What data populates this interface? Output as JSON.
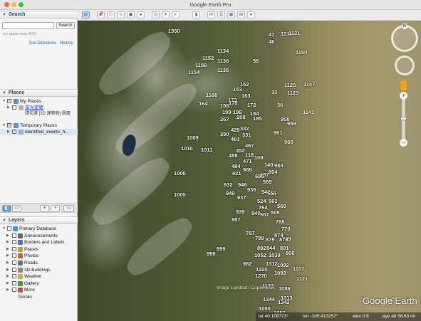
{
  "window": {
    "title": "Google Earth Pro"
  },
  "search": {
    "header": "Search",
    "placeholder": "",
    "button": "Search",
    "hint": "ex: pizza near NYC",
    "get_directions": "Get Directions",
    "history": "History"
  },
  "places": {
    "header": "Places",
    "my_places": "My Places",
    "sightseeing": "景光遊覽",
    "sightseeing_note": "請勾選 [3D 建築物] 圖層",
    "temporary": "Temporary Places",
    "kml_file": "Identified_events_fr..."
  },
  "layers": {
    "header": "Layers",
    "items": [
      {
        "label": "Primary Database",
        "icon": "globe-icon",
        "color": "#4a90d9"
      },
      {
        "label": "Announcements",
        "icon": "announcement-icon",
        "color": "#666666"
      },
      {
        "label": "Borders and Labels",
        "icon": "borders-icon",
        "color": "#3f78c8"
      },
      {
        "label": "Places",
        "icon": "place-icon",
        "color": "#c8a020"
      },
      {
        "label": "Photos",
        "icon": "photo-icon",
        "color": "#d06030"
      },
      {
        "label": "Roads",
        "icon": "road-icon",
        "color": "#707070"
      },
      {
        "label": "3D Buildings",
        "icon": "building-icon",
        "color": "#8a8a8a"
      },
      {
        "label": "Weather",
        "icon": "weather-icon",
        "color": "#e0b020"
      },
      {
        "label": "Gallery",
        "icon": "gallery-icon",
        "color": "#3aa040"
      },
      {
        "label": "More",
        "icon": "more-icon",
        "color": "#c05050"
      },
      {
        "label": "Terrain",
        "icon": "",
        "color": ""
      }
    ]
  },
  "map": {
    "imagery_credit": "Image Landsat / Copernicus",
    "brand": "Google Earth",
    "status": {
      "lat": "lat  40.108773°",
      "lon": "lon -105.413257°",
      "elev": "elev     0 ft",
      "eye_alt": "eye alt  56.63 mi"
    },
    "compass_label": "N"
  },
  "events": [
    {
      "id": "1350"
    },
    {
      "id": "47"
    },
    {
      "id": "46"
    },
    {
      "id": "131"
    },
    {
      "id": "1131"
    },
    {
      "id": "1134"
    },
    {
      "id": "1150"
    },
    {
      "id": "1152"
    },
    {
      "id": "1156"
    },
    {
      "id": "1136"
    },
    {
      "id": "1135"
    },
    {
      "id": "1154"
    },
    {
      "id": "56"
    },
    {
      "id": "152"
    },
    {
      "id": "153"
    },
    {
      "id": "1125"
    },
    {
      "id": "1147"
    },
    {
      "id": "1123"
    },
    {
      "id": "1168"
    },
    {
      "id": "163"
    },
    {
      "id": "173"
    },
    {
      "id": "33"
    },
    {
      "id": "164"
    },
    {
      "id": "158"
    },
    {
      "id": "178"
    },
    {
      "id": "172"
    },
    {
      "id": "36"
    },
    {
      "id": "1141"
    },
    {
      "id": "199"
    },
    {
      "id": "198"
    },
    {
      "id": "184"
    },
    {
      "id": "185"
    },
    {
      "id": "267"
    },
    {
      "id": "208"
    },
    {
      "id": "958"
    },
    {
      "id": "959"
    },
    {
      "id": "332"
    },
    {
      "id": "390"
    },
    {
      "id": "429"
    },
    {
      "id": "331"
    },
    {
      "id": "961"
    },
    {
      "id": "1009"
    },
    {
      "id": "461"
    },
    {
      "id": "965"
    },
    {
      "id": "467"
    },
    {
      "id": "1010"
    },
    {
      "id": "1011"
    },
    {
      "id": "352"
    },
    {
      "id": "118"
    },
    {
      "id": "488"
    },
    {
      "id": "109"
    },
    {
      "id": "471"
    },
    {
      "id": "140"
    },
    {
      "id": "984"
    },
    {
      "id": "484"
    },
    {
      "id": "988"
    },
    {
      "id": "604"
    },
    {
      "id": "921"
    },
    {
      "id": "697"
    },
    {
      "id": "696"
    },
    {
      "id": "1000"
    },
    {
      "id": "932"
    },
    {
      "id": "946"
    },
    {
      "id": "936"
    },
    {
      "id": "589"
    },
    {
      "id": "949"
    },
    {
      "id": "542"
    },
    {
      "id": "556"
    },
    {
      "id": "937"
    },
    {
      "id": "1005"
    },
    {
      "id": "524"
    },
    {
      "id": "562"
    },
    {
      "id": "939"
    },
    {
      "id": "764"
    },
    {
      "id": "568"
    },
    {
      "id": "940"
    },
    {
      "id": "507"
    },
    {
      "id": "509"
    },
    {
      "id": "997"
    },
    {
      "id": "768"
    },
    {
      "id": "770"
    },
    {
      "id": "769"
    },
    {
      "id": "787"
    },
    {
      "id": "874"
    },
    {
      "id": "788"
    },
    {
      "id": "879"
    },
    {
      "id": "873"
    },
    {
      "id": "892"
    },
    {
      "id": "844"
    },
    {
      "id": "801"
    },
    {
      "id": "999"
    },
    {
      "id": "998"
    },
    {
      "id": "1052"
    },
    {
      "id": "1039"
    },
    {
      "id": "800"
    },
    {
      "id": "982"
    },
    {
      "id": "1312"
    },
    {
      "id": "1092"
    },
    {
      "id": "1107"
    },
    {
      "id": "1320"
    },
    {
      "id": "1093"
    },
    {
      "id": "1270"
    },
    {
      "id": "1121"
    },
    {
      "id": "1133"
    },
    {
      "id": "1089"
    },
    {
      "id": "1344"
    },
    {
      "id": "1342"
    },
    {
      "id": "1055"
    },
    {
      "id": "1057"
    },
    {
      "id": "1313"
    }
  ]
}
